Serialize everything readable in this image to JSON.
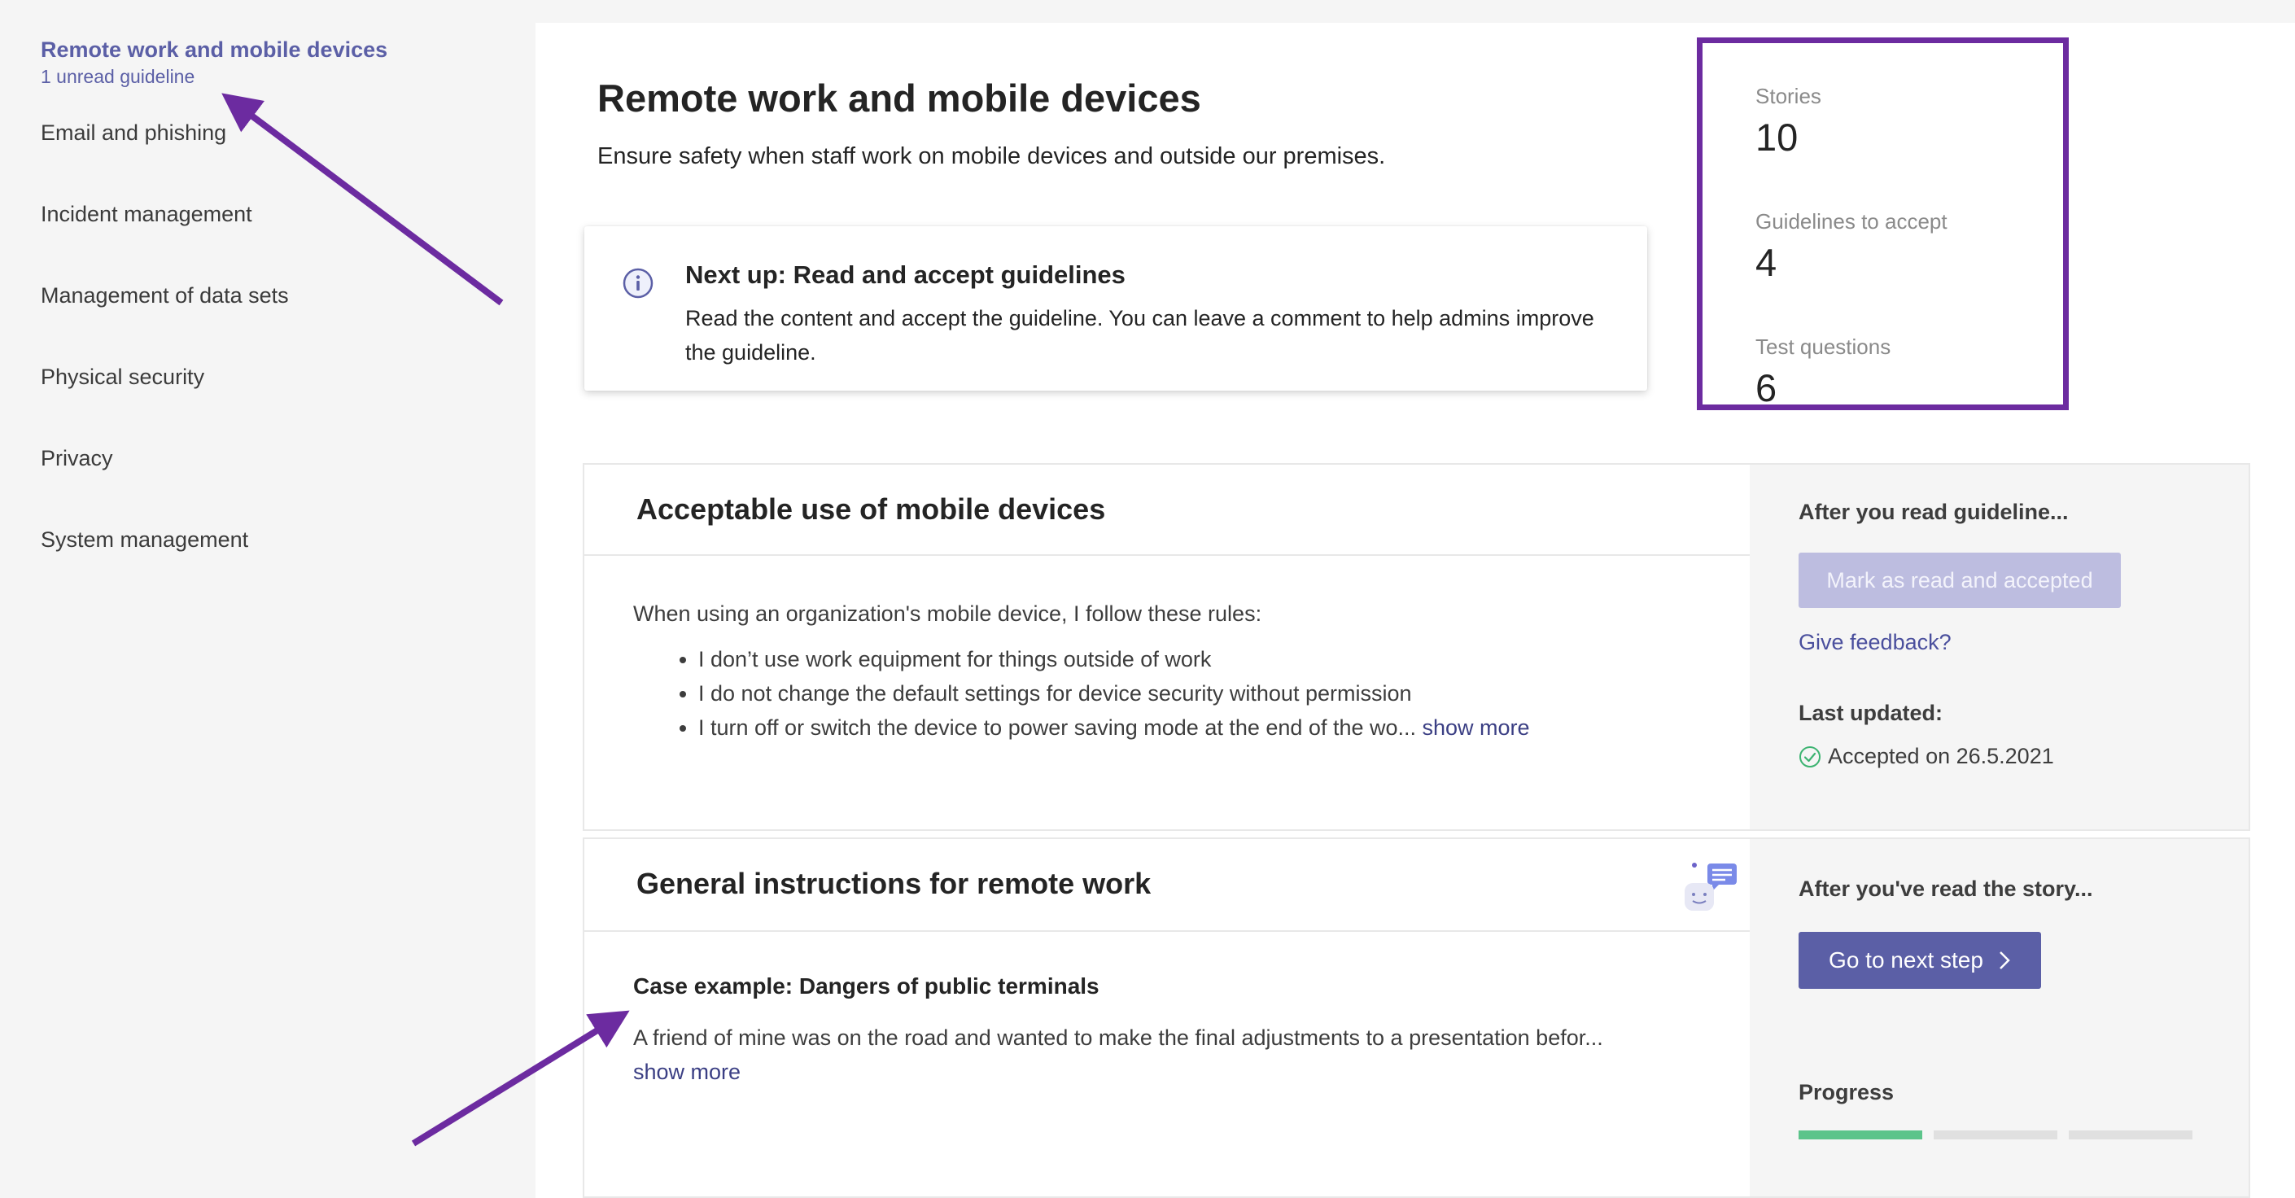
{
  "sidebar": {
    "items": [
      {
        "label": "Remote work and mobile devices",
        "sub": "1 unread guideline",
        "active": true
      },
      {
        "label": "Email and phishing"
      },
      {
        "label": "Incident management"
      },
      {
        "label": "Management of data sets"
      },
      {
        "label": "Physical security"
      },
      {
        "label": "Privacy"
      },
      {
        "label": "System management"
      }
    ]
  },
  "page": {
    "title": "Remote work and mobile devices",
    "description": "Ensure safety when staff work on mobile devices and outside our premises."
  },
  "next_up": {
    "icon": "info-icon",
    "title": "Next up: Read and accept guidelines",
    "text": "Read the content and accept the guideline. You can leave a comment to help admins improve the guideline."
  },
  "stats": {
    "stories_label": "Stories",
    "stories_value": "10",
    "guidelines_label": "Guidelines to accept",
    "guidelines_value": "4",
    "tests_label": "Test questions",
    "tests_value": "6",
    "highlight_color": "#6c2ba0"
  },
  "guideline_card": {
    "title": "Acceptable use of mobile devices",
    "intro": "When using an organization's mobile device, I follow these rules:",
    "bullets": [
      "I don’t use work equipment for things outside of work",
      "I do not change the default settings for device security without permission",
      "I turn off or switch the device to power saving mode at the end of the wo..."
    ],
    "show_more": "show more",
    "right_heading": "After you read guideline...",
    "mark_button": "Mark as read and accepted",
    "feedback_link": "Give feedback?",
    "last_updated_label": "Last updated:",
    "accepted_text": "Accepted on 26.5.2021"
  },
  "story_card": {
    "title": "General instructions for remote work",
    "case_title": "Case example: Dangers of public terminals",
    "case_text": "A friend of mine was on the road and wanted to make the final adjustments to a presentation befor...",
    "show_more": "show more",
    "right_heading": "After you've read the story...",
    "next_button": "Go to next step",
    "progress_label": "Progress",
    "progress": {
      "completed_steps": 1,
      "total_steps": 3
    },
    "progress_done_color": "#5cc48a"
  },
  "colors": {
    "accent": "#5b5fa6",
    "annotation": "#6c2ba0"
  }
}
